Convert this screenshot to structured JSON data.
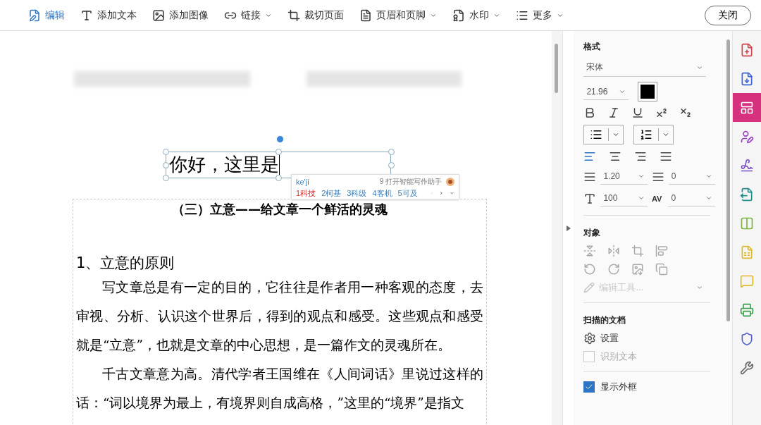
{
  "toolbar": {
    "items": [
      {
        "kind": "edit",
        "label": "编辑",
        "selected": true,
        "dropdown": false
      },
      {
        "kind": "text",
        "label": "添加文本",
        "selected": false,
        "dropdown": false
      },
      {
        "kind": "image",
        "label": "添加图像",
        "selected": false,
        "dropdown": false
      },
      {
        "kind": "link",
        "label": "链接",
        "selected": false,
        "dropdown": true
      },
      {
        "kind": "crop",
        "label": "裁切页面",
        "selected": false,
        "dropdown": false
      },
      {
        "kind": "header",
        "label": "页眉和页脚",
        "selected": false,
        "dropdown": true
      },
      {
        "kind": "watermark",
        "label": "水印",
        "selected": false,
        "dropdown": true
      },
      {
        "kind": "more",
        "label": "更多",
        "selected": false,
        "dropdown": true
      }
    ],
    "close_button": "关闭"
  },
  "editor": {
    "text_box": {
      "value": "你好，这里是"
    },
    "ime": {
      "input": "ke'ji",
      "hint_number": "9",
      "hint": "打开智能写作助手",
      "candidates": [
        {
          "number": "1",
          "text": "科技",
          "selected": true
        },
        {
          "number": "2",
          "text": "柯基",
          "selected": false
        },
        {
          "number": "3",
          "text": "科级",
          "selected": false
        },
        {
          "number": "4",
          "text": "客机",
          "selected": false
        },
        {
          "number": "5",
          "text": "可及",
          "selected": false
        }
      ]
    },
    "page": {
      "title": "（三）立意——给文章一个鲜活的灵魂",
      "heading": "1、立意的原则",
      "paragraphs": [
        "写文章总是有一定的目的，它往往是作者用一种客观的态度，去审视、分析、认识这个世界后，得到的观点和感受。这些观点和感受就是“立意”，也就是文章的中心思想，是一篇作文的灵魂所在。",
        "千古文章意为高。清代学者王国维在《人间词话》里说过这样的话：“词以境界为最上，有境界则自成高格，”这里的“境界”是指文"
      ]
    }
  },
  "panel": {
    "format": {
      "title": "格式",
      "font": "宋体",
      "size": "21.96",
      "align": [
        {
          "kind": "left",
          "selected": true
        },
        {
          "kind": "center",
          "selected": false
        },
        {
          "kind": "right",
          "selected": false
        },
        {
          "kind": "justify",
          "selected": false
        }
      ],
      "line_spacing": "1.20",
      "paragraph_spacing": "0",
      "scale": "100",
      "tracking_label": "AV",
      "tracking": "0"
    },
    "object": {
      "title": "对象",
      "edit_tools": {
        "label": "编辑工具...",
        "disabled": true
      }
    },
    "scanned": {
      "title": "扫描的文档",
      "settings": "设置",
      "options": [
        {
          "label": "识别文本",
          "checked": false,
          "disabled": true
        },
        {
          "label": "显示外框",
          "checked": true,
          "disabled": false
        }
      ]
    }
  },
  "rail": [
    {
      "kind": "create",
      "color": "#d0434b",
      "selected": false
    },
    {
      "kind": "export",
      "color": "#3b63d6",
      "selected": false
    },
    {
      "kind": "organize",
      "color": "#d6317f",
      "selected": true
    },
    {
      "kind": "sign",
      "color": "#9b3fc0",
      "selected": false
    },
    {
      "kind": "fill",
      "color": "#7a4fc4",
      "selected": false
    },
    {
      "kind": "send",
      "color": "#1f8f8a",
      "selected": false
    },
    {
      "kind": "compare",
      "color": "#7cb342",
      "selected": false
    },
    {
      "kind": "comment-file",
      "color": "#e0b82b",
      "selected": false
    },
    {
      "kind": "comment",
      "color": "#e0b82b",
      "selected": false
    },
    {
      "kind": "scan",
      "color": "#3aa14b",
      "selected": false
    },
    {
      "kind": "protect",
      "color": "#5561c9",
      "selected": false
    },
    {
      "kind": "tools",
      "color": "#666666",
      "selected": false
    }
  ]
}
